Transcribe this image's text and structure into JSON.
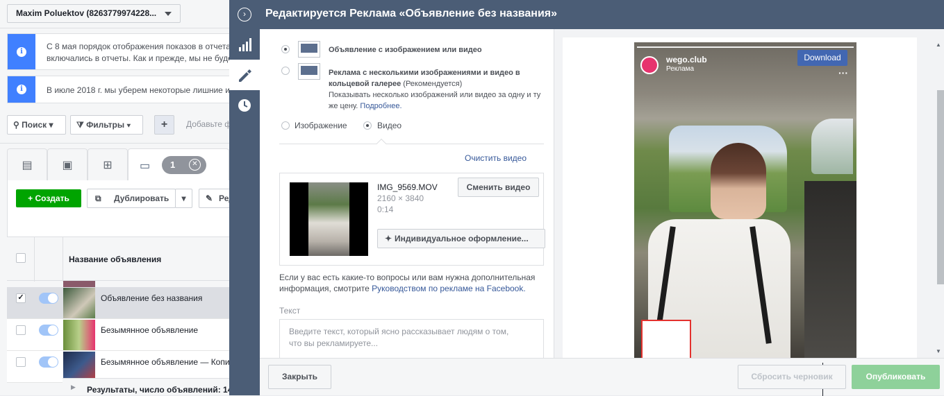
{
  "background": {
    "account_selector": "Maxim Poluektov (8263779974228...",
    "notices": [
      "С 8 мая порядок отображения показов в отчета",
      "включались в отчеты. Как и прежде, мы не буде",
      "В июле 2018 г. мы уберем некоторые лишние и"
    ],
    "toolbar": {
      "search": "Поиск",
      "filters": "Фильтры",
      "add": "+",
      "add_hint": "Добавьте ф"
    },
    "tab_badge": "1",
    "actions": {
      "create": "+ Создать",
      "duplicate": "Дублировать",
      "edit": "Ред"
    },
    "table": {
      "header": "Название объявления",
      "rows": [
        {
          "name": "Объявление без названия",
          "checked": true
        },
        {
          "name": "Безымянное объявление",
          "checked": false
        },
        {
          "name": "Безымянное объявление — Копи",
          "checked": false
        }
      ],
      "footer": "Результаты, число объявлений: 14"
    }
  },
  "modal": {
    "title": "Редактируется Реклама «Объявление без названия»",
    "format": {
      "single": "Объявление с изображением или видео",
      "carousel_title": "Реклама с несколькими изображениями и видео в кольцевой галерее",
      "carousel_title_l1": "Реклама с несколькими изображениями и видео в",
      "carousel_title_l2": "кольцевой галерее",
      "recommended": "(Рекомендуется)",
      "carousel_desc_l1": "Показывать несколько изображений или видео за одну и ту",
      "carousel_desc_l2": "же цену.",
      "more_link": "Подробнее."
    },
    "media_type": {
      "image": "Изображение",
      "video": "Видео"
    },
    "clear_video": "Очистить видео",
    "video": {
      "filename": "IMG_9569.MOV",
      "dimensions": "2160 × 3840",
      "duration": "0:14",
      "change_button": "Сменить видео",
      "custom_button": "Индивидуальное оформление..."
    },
    "help_l1": "Если у вас есть какие-то вопросы или вам нужна дополнительная",
    "help_l2_prefix": "информация, смотрите",
    "help_link": "Руководством по рекламе на Facebook.",
    "text_label": "Текст",
    "text_placeholder": "Введите текст, который ясно рассказывает людям о том, что вы рекламируете...",
    "preview": {
      "account": "wego.club",
      "sponsored": "Реклама",
      "download": "Download"
    },
    "footer": {
      "close": "Закрыть",
      "reset": "Сбросить черновик",
      "publish": "Опубликовать"
    },
    "colors": {
      "header": "#4b5d76",
      "publish": "#8ed19a",
      "link": "#365899",
      "create": "#00a400"
    }
  }
}
